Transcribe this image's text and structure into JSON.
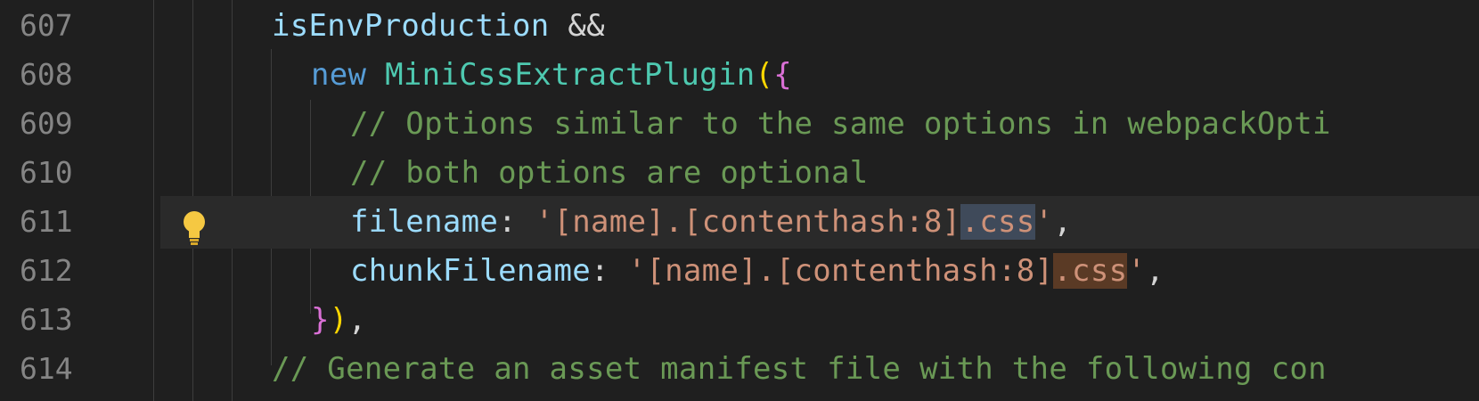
{
  "lines": [
    {
      "num": "607",
      "text": "isEnvProduction &&"
    },
    {
      "num": "608",
      "text": "new MiniCssExtractPlugin({"
    },
    {
      "num": "609",
      "text": "// Options similar to the same options in webpackOpti"
    },
    {
      "num": "610",
      "text": "// both options are optional"
    },
    {
      "num": "611",
      "text": "filename: '[name].[contenthash:8].css',"
    },
    {
      "num": "612",
      "text": "chunkFilename: '[name].[contenthash:8].css',"
    },
    {
      "num": "613",
      "text": "}),"
    },
    {
      "num": "614",
      "text": "// Generate an asset manifest file with the following con"
    }
  ],
  "tokens": {
    "l607_var": "isEnvProduction",
    "l607_op": " &&",
    "l608_kw": "new",
    "l608_cls": "MiniCssExtractPlugin",
    "l608_p1": "(",
    "l608_p2": "{",
    "l609_cmt": "// Options similar to the same options in webpackOpti",
    "l610_cmt": "// both options are optional",
    "l611_prop": "filename",
    "l611_colon": ": ",
    "l611_str1": "'[name].[contenthash:8]",
    "l611_str2": ".css",
    "l611_str3": "'",
    "l611_end": ",",
    "l612_prop": "chunkFilename",
    "l612_colon": ": ",
    "l612_str1": "'[name].[contenthash:8]",
    "l612_str2": ".css",
    "l612_str3": "'",
    "l612_end": ",",
    "l613_b": "}",
    "l613_p": ")",
    "l613_end": ",",
    "l614_cmt": "// Generate an asset manifest file with the following con"
  },
  "icons": {
    "lightbulb": "lightbulb-icon"
  },
  "colors": {
    "background": "#1f1f1f",
    "line_number": "#858585",
    "keyword": "#569cd6",
    "class": "#4ec9b0",
    "variable": "#9cdcfe",
    "comment": "#6a9955",
    "string": "#ce9178",
    "bracket": "#ffd700",
    "lightbulb": "#f5c842"
  }
}
